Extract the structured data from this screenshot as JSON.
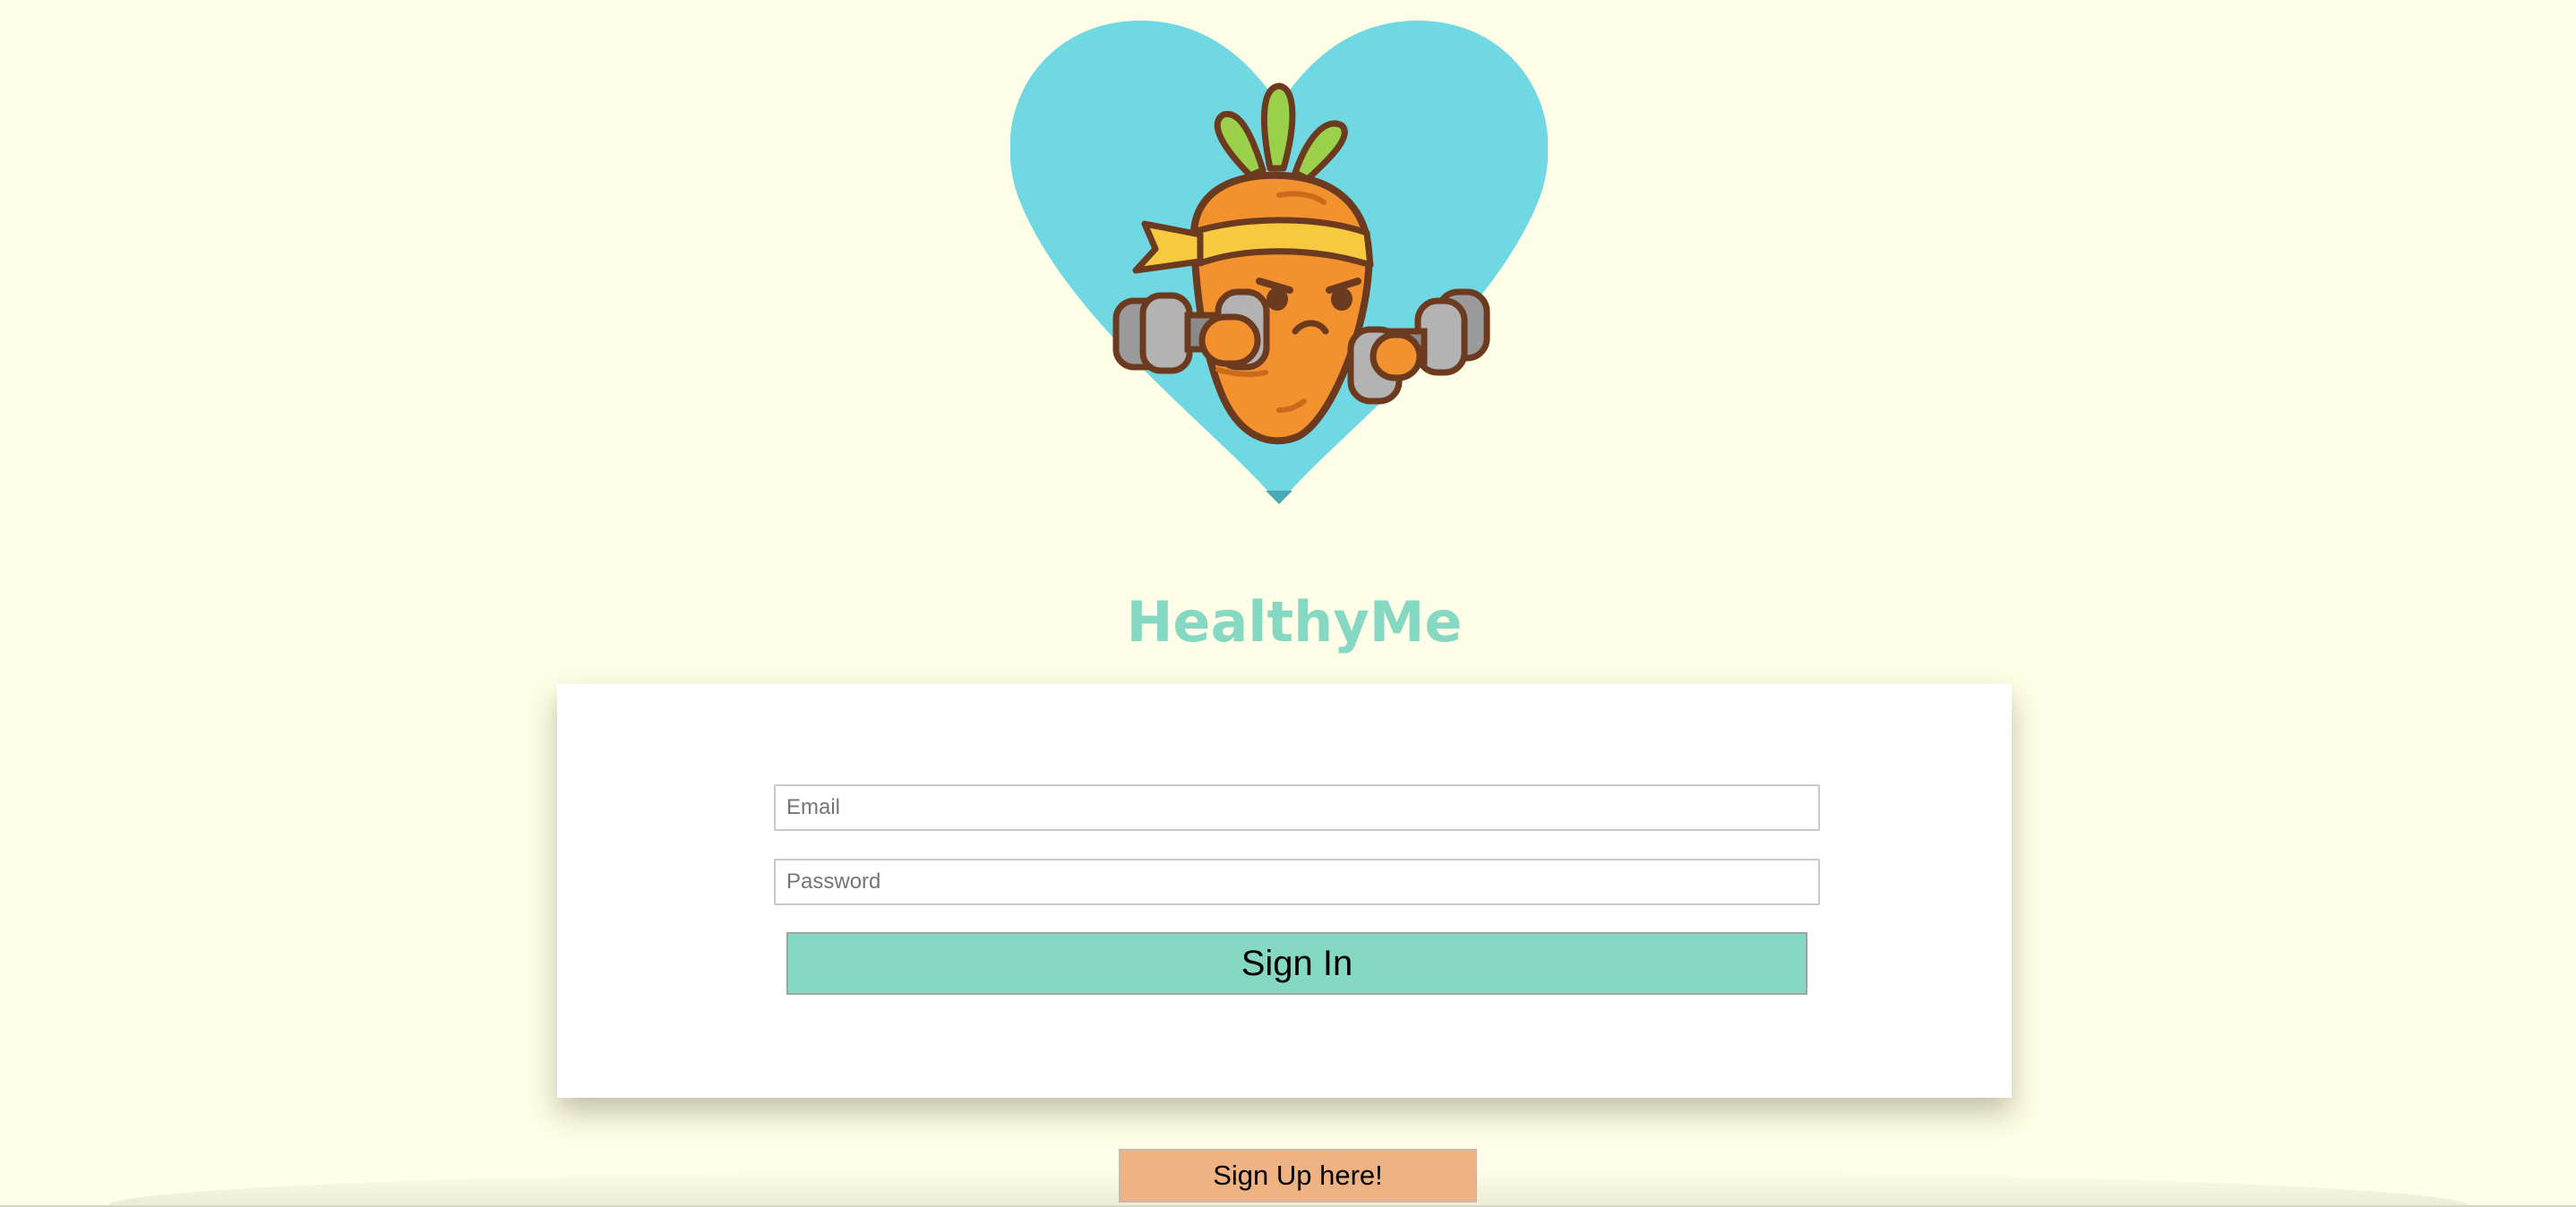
{
  "app": {
    "title": "HealthyMe"
  },
  "colors": {
    "background": "#fffee6",
    "accent": "#85d8c1",
    "heart": "#6fd8e2",
    "signup": "#efb283"
  },
  "logo": {
    "icon": "carrot-mascot-with-dumbbells-in-heart-icon"
  },
  "login_form": {
    "email": {
      "value": "",
      "placeholder": "Email"
    },
    "password": {
      "value": "",
      "placeholder": "Password"
    },
    "sign_in_label": "Sign In"
  },
  "signup": {
    "label": "Sign Up here!"
  }
}
